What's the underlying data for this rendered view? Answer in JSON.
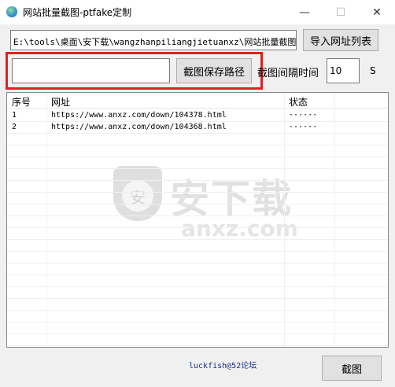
{
  "window": {
    "title": "网站批量截图-ptfake定制",
    "min_glyph": "—",
    "max_glyph": "☐",
    "close_glyph": "✕"
  },
  "url_list_path": "E:\\tools\\桌面\\安下载\\wangzhanpiliangjietuanxz\\网站批量截图\\",
  "import_button": "导入网址列表",
  "save_path_value": "",
  "save_path_button": "截图保存路径",
  "interval": {
    "label": "截图间隔时间",
    "value": "10",
    "unit": "S"
  },
  "list": {
    "headers": [
      "序号",
      "网址",
      "状态"
    ],
    "rows": [
      {
        "index": "1",
        "url": "https://www.anxz.com/down/104378.html",
        "status": "······"
      },
      {
        "index": "2",
        "url": "https://www.anxz.com/down/104368.html",
        "status": "······"
      }
    ]
  },
  "watermark": {
    "cn": "安下载",
    "en": "anxz.com",
    "shield": "安"
  },
  "footer_credit": "luckfish@52论坛",
  "capture_button": "截图",
  "colors": {
    "highlight": "#e02020",
    "credit": "#1a2f8a"
  }
}
